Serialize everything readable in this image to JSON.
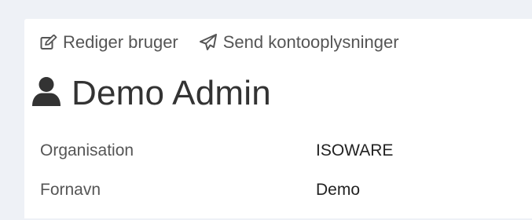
{
  "toolbar": {
    "edit_label": "Rediger bruger",
    "edit_icon": "edit-icon",
    "send_label": "Send kontooplysninger",
    "send_icon": "paper-plane-icon"
  },
  "user": {
    "icon": "user-icon",
    "name": "Demo Admin"
  },
  "fields": [
    {
      "label": "Organisation",
      "value": "ISOWARE"
    },
    {
      "label": "Fornavn",
      "value": "Demo"
    }
  ],
  "colors": {
    "page_background": "#eef1f6",
    "panel_background": "#ffffff",
    "text": "#444444"
  }
}
